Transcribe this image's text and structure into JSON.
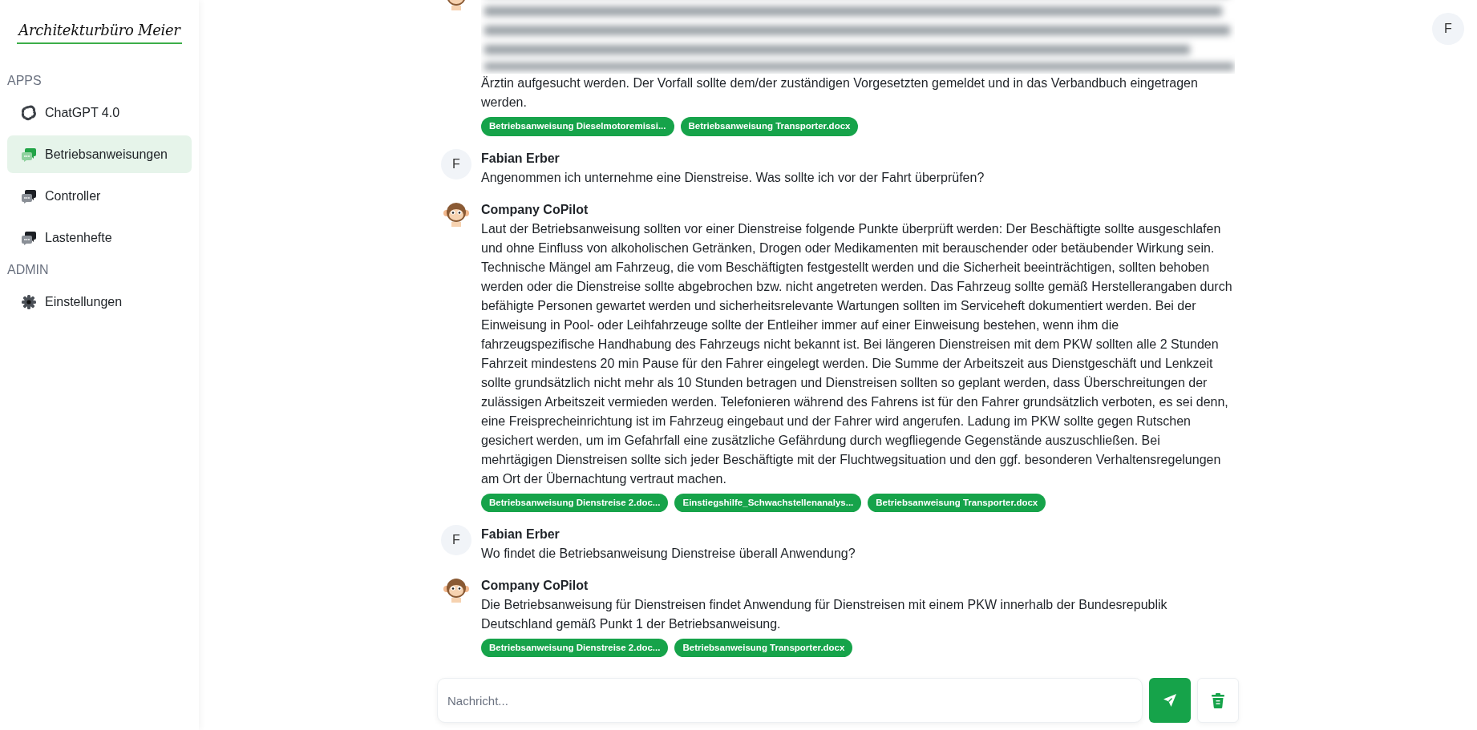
{
  "logo": {
    "text": "Architekturbüro Meier"
  },
  "sidebar": {
    "sections": [
      {
        "title": "APPS",
        "items": [
          {
            "label": "ChatGPT 4.0",
            "kind": "model",
            "selected": false
          },
          {
            "label": "Betriebsanweisungen",
            "kind": "chat",
            "selected": true
          },
          {
            "label": "Controller",
            "kind": "chat",
            "selected": false
          },
          {
            "label": "Lastenhefte",
            "kind": "chat",
            "selected": false
          }
        ]
      },
      {
        "title": "ADMIN",
        "items": [
          {
            "label": "Einstellungen",
            "kind": "settings",
            "selected": false
          }
        ]
      }
    ]
  },
  "profile": {
    "initial": "F"
  },
  "messages": [
    {
      "kind": "bot",
      "blurred": true,
      "text": "Ärztin aufgesucht werden. Der Vorfall sollte dem/der zuständigen Vorgesetzten gemeldet und in das Verbandbuch eingetragen werden.",
      "sources": [
        "Betriebsanweisung Dieselmotoremissi...",
        "Betriebsanweisung Transporter.docx"
      ]
    },
    {
      "kind": "user",
      "initial": "F",
      "author": "Fabian Erber",
      "text": "Angenommen ich unternehme eine Dienstreise. Was sollte ich vor der Fahrt überprüfen?"
    },
    {
      "kind": "bot",
      "author": "Company CoPilot",
      "text": "Laut der Betriebsanweisung sollten vor einer Dienstreise folgende Punkte überprüft werden: Der Beschäftigte sollte ausgeschlafen und ohne Einfluss von alkoholischen Getränken, Drogen oder Medikamenten mit berauschender oder betäubender Wirkung sein. Technische Mängel am Fahrzeug, die vom Beschäftigten festgestellt werden und die Sicherheit beeinträchtigen, sollten behoben werden oder die Dienstreise sollte abgebrochen bzw. nicht angetreten werden. Das Fahrzeug sollte gemäß Herstellerangaben durch befähigte Personen gewartet werden und sicherheitsrelevante Wartungen sollten im Serviceheft dokumentiert werden. Bei der Einweisung in Pool- oder Leihfahrzeuge sollte der Entleiher immer auf einer Einweisung bestehen, wenn ihm die fahrzeugspezifische Handhabung des Fahrzeugs nicht bekannt ist. Bei längeren Dienstreisen mit dem PKW sollten alle 2 Stunden Fahrzeit mindestens 20 min Pause für den Fahrer eingelegt werden. Die Summe der Arbeitszeit aus Dienstgeschäft und Lenkzeit sollte grundsätzlich nicht mehr als 10 Stunden betragen und Dienstreisen sollten so geplant werden, dass Überschreitungen der zulässigen Arbeitszeit vermieden werden. Telefonieren während des Fahrens ist für den Fahrer grundsätzlich verboten, es sei denn, eine Freisprecheinrichtung ist im Fahrzeug eingebaut und der Fahrer wird angerufen. Ladung im PKW sollte gegen Rutschen gesichert werden, um im Gefahrfall eine zusätzliche Gefährdung durch wegfliegende Gegenstände auszuschließen. Bei mehrtägigen Dienstreisen sollte sich jeder Beschäftigte mit der Fluchtwegsituation und den ggf. besonderen Verhaltensregelungen am Ort der Übernachtung vertraut machen.",
      "sources": [
        "Betriebsanweisung Dienstreise 2.doc...",
        "Einstiegshilfe_Schwachstellenanalys...",
        "Betriebsanweisung Transporter.docx"
      ]
    },
    {
      "kind": "user",
      "initial": "F",
      "author": "Fabian Erber",
      "text": "Wo findet die Betriebsanweisung Dienstreise überall Anwendung?"
    },
    {
      "kind": "bot",
      "author": "Company CoPilot",
      "text": "Die Betriebsanweisung für Dienstreisen findet Anwendung für Dienstreisen mit einem PKW innerhalb der Bundesrepublik Deutschland gemäß Punkt 1 der Betriebsanweisung.",
      "sources": [
        "Betriebsanweisung Dienstreise 2.doc...",
        "Betriebsanweisung Transporter.docx"
      ]
    }
  ],
  "composer": {
    "placeholder": "Nachricht..."
  }
}
